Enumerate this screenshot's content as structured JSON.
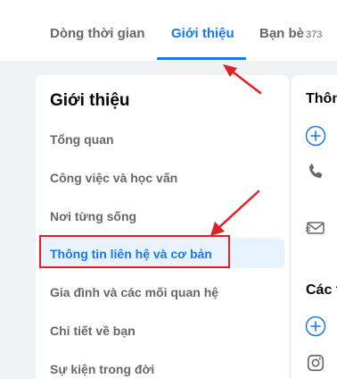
{
  "tabs": [
    {
      "label": "Dòng thời gian"
    },
    {
      "label": "Giới thiệu"
    },
    {
      "label": "Bạn bè",
      "count": "373"
    }
  ],
  "about": {
    "title": "Giới thiệu",
    "items": [
      {
        "label": "Tổng quan"
      },
      {
        "label": "Công việc và học vấn"
      },
      {
        "label": "Nơi từng sống"
      },
      {
        "label": "Thông tin liên hệ và cơ bản"
      },
      {
        "label": "Gia đình và các mối quan hệ"
      },
      {
        "label": "Chi tiết về bạn"
      },
      {
        "label": "Sự kiện trong đời"
      }
    ]
  },
  "right": {
    "title1": "Thôn",
    "title2": "Các t"
  },
  "colors": {
    "accent": "#1877f2",
    "annotation": "#e41e26"
  }
}
